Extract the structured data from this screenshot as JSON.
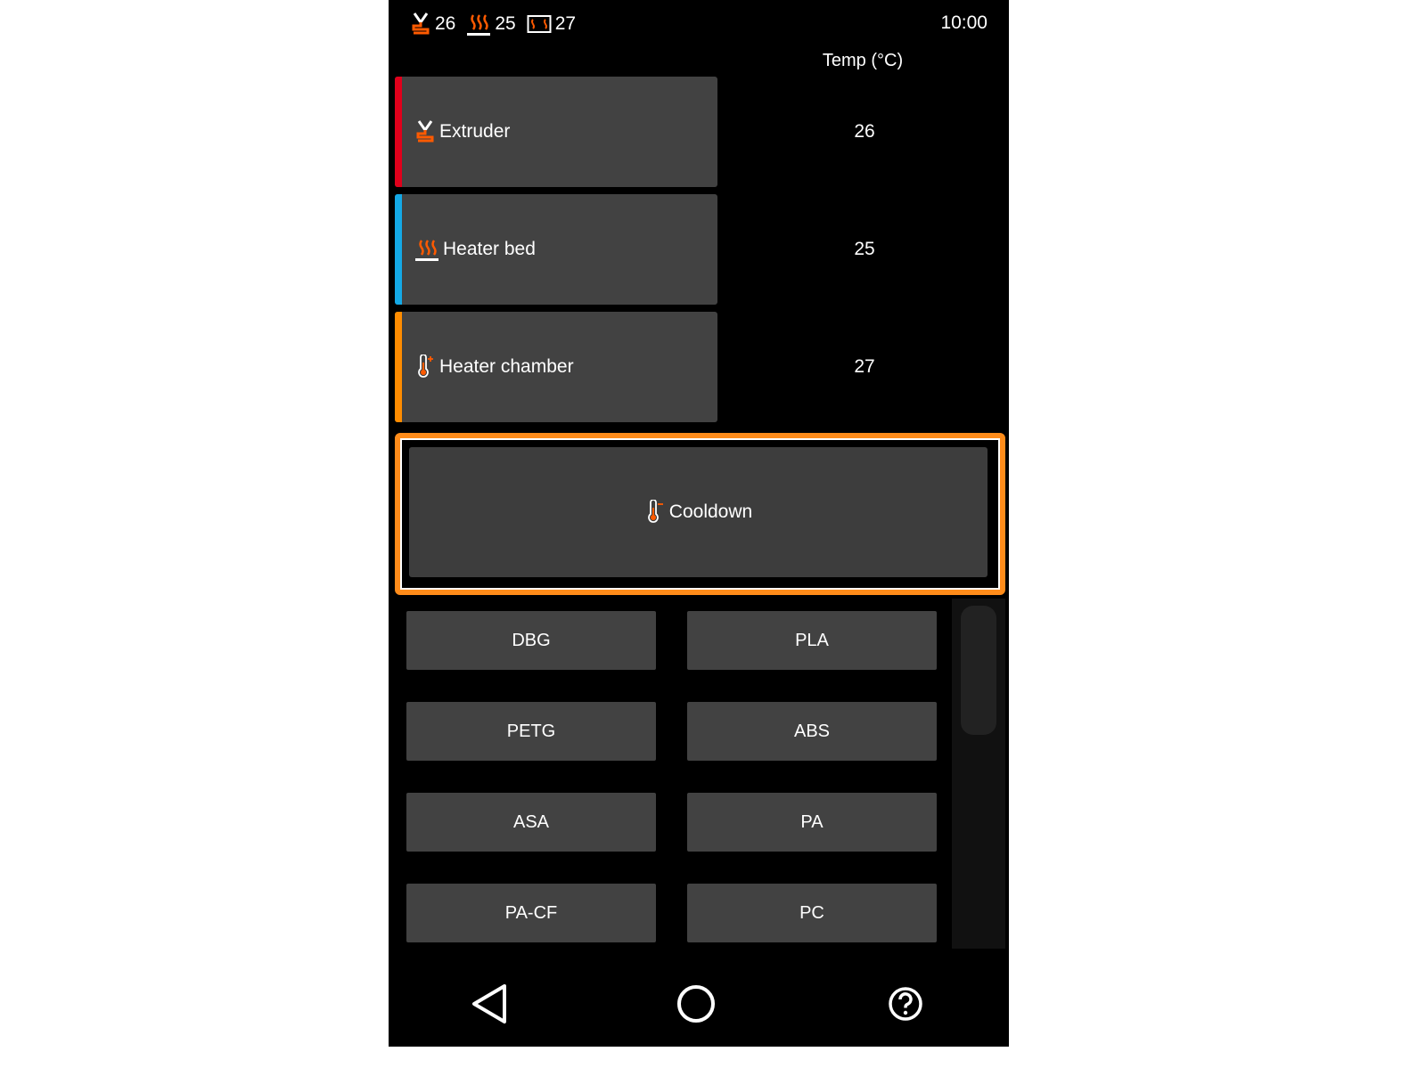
{
  "status_bar": {
    "extruder_temp": "26",
    "bed_temp": "25",
    "chamber_temp": "27",
    "time": "10:00",
    "icons": [
      "extruder-icon",
      "heater-bed-icon",
      "chamber-icon"
    ]
  },
  "header": {
    "temp_label": "Temp (°C)"
  },
  "heaters": [
    {
      "label": "Extruder",
      "value": "26",
      "color": "#e0001b",
      "icon": "extruder-icon"
    },
    {
      "label": "Heater bed",
      "value": "25",
      "color": "#14a9e6",
      "icon": "heater-bed-icon"
    },
    {
      "label": "Heater chamber",
      "value": "27",
      "color": "#ff8c00",
      "icon": "thermometer-plus-icon"
    }
  ],
  "cooldown": {
    "label": "Cooldown",
    "icon": "thermometer-minus-icon",
    "focus_color": "#ff8c1a"
  },
  "presets": [
    "DBG",
    "PLA",
    "PETG",
    "ABS",
    "ASA",
    "PA",
    "PA-CF",
    "PC"
  ],
  "nav": {
    "icons": [
      "back-icon",
      "home-icon",
      "help-icon"
    ]
  },
  "colors": {
    "accent": "#ff5a00",
    "card": "#424242",
    "background": "#000000"
  }
}
